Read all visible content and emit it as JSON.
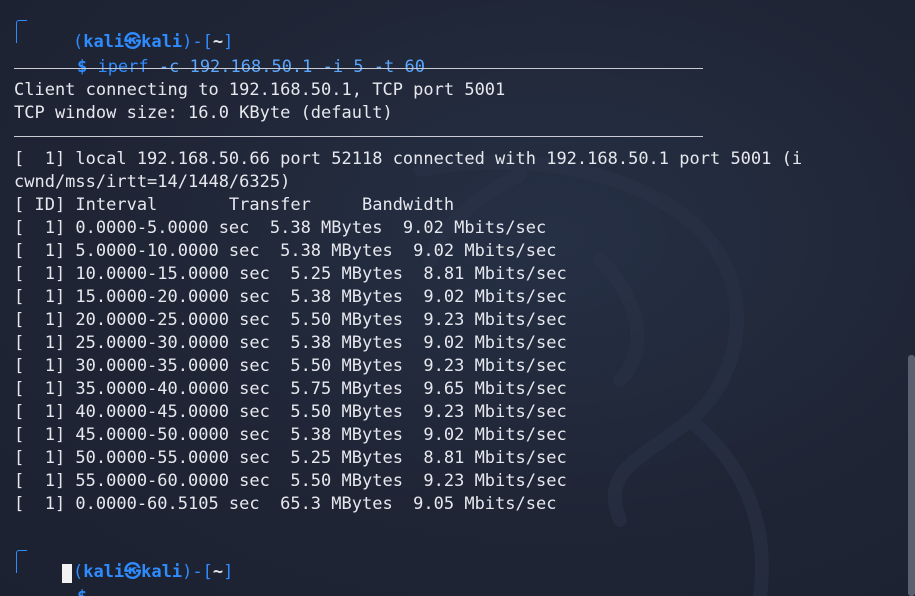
{
  "prompt1": {
    "user": "kali",
    "host": "kali",
    "at_symbol": "㉿",
    "dir": "~",
    "dollar": "$",
    "command": "iperf",
    "args": " -c 192.168.50.1 -i 5 -t 60"
  },
  "output": {
    "connect_line": "Client connecting to 192.168.50.1, TCP port 5001",
    "window_line": "TCP window size: 16.0 KByte (default)",
    "local_line": "[  1] local 192.168.50.66 port 52118 connected with 192.168.50.1 port 5001 (i",
    "cwnd_line": "cwnd/mss/irtt=14/1448/6325)",
    "header_line": "[ ID] Interval       Transfer     Bandwidth",
    "rows": [
      "[  1] 0.0000-5.0000 sec  5.38 MBytes  9.02 Mbits/sec",
      "[  1] 5.0000-10.0000 sec  5.38 MBytes  9.02 Mbits/sec",
      "[  1] 10.0000-15.0000 sec  5.25 MBytes  8.81 Mbits/sec",
      "[  1] 15.0000-20.0000 sec  5.38 MBytes  9.02 Mbits/sec",
      "[  1] 20.0000-25.0000 sec  5.50 MBytes  9.23 Mbits/sec",
      "[  1] 25.0000-30.0000 sec  5.38 MBytes  9.02 Mbits/sec",
      "[  1] 30.0000-35.0000 sec  5.50 MBytes  9.23 Mbits/sec",
      "[  1] 35.0000-40.0000 sec  5.75 MBytes  9.65 Mbits/sec",
      "[  1] 40.0000-45.0000 sec  5.50 MBytes  9.23 Mbits/sec",
      "[  1] 45.0000-50.0000 sec  5.38 MBytes  9.02 Mbits/sec",
      "[  1] 50.0000-55.0000 sec  5.25 MBytes  8.81 Mbits/sec",
      "[  1] 55.0000-60.0000 sec  5.50 MBytes  9.23 Mbits/sec",
      "[  1] 0.0000-60.5105 sec  65.3 MBytes  9.05 Mbits/sec"
    ]
  },
  "prompt2": {
    "user": "kali",
    "host": "kali",
    "at_symbol": "㉿",
    "dir": "~",
    "dollar": "$"
  },
  "colors": {
    "background": "#212838",
    "prompt_blue": "#2f8cff",
    "text": "#e6e8ee"
  }
}
